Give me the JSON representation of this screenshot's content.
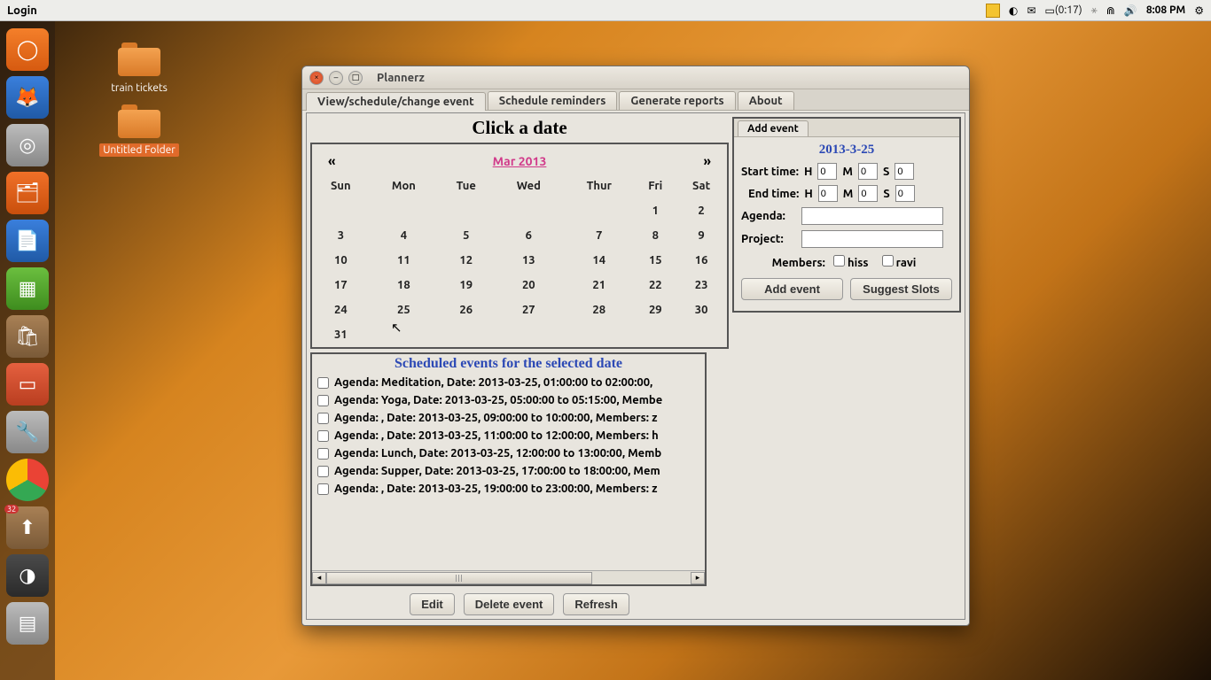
{
  "topbar": {
    "title": "Login",
    "battery": "(0:17)",
    "time": "8:08 PM"
  },
  "desktop": {
    "folder1": "train tickets",
    "folder2": "Untitled Folder"
  },
  "window": {
    "title": "Plannerz",
    "tabs": [
      "View/schedule/change event",
      "Schedule reminders",
      "Generate reports",
      "About"
    ],
    "heading": "Click a date"
  },
  "calendar": {
    "prev": "«",
    "next": "»",
    "month": "Mar 2013",
    "days": [
      "Sun",
      "Mon",
      "Tue",
      "Wed",
      "Thur",
      "Fri",
      "Sat"
    ],
    "weeks": [
      [
        "",
        "",
        "",
        "",
        "",
        "1",
        "2"
      ],
      [
        "3",
        "4",
        "5",
        "6",
        "7",
        "8",
        "9"
      ],
      [
        "10",
        "11",
        "12",
        "13",
        "14",
        "15",
        "16"
      ],
      [
        "17",
        "18",
        "19",
        "20",
        "21",
        "22",
        "23"
      ],
      [
        "24",
        "25",
        "26",
        "27",
        "28",
        "29",
        "30"
      ],
      [
        "31",
        "",
        "",
        "",
        "",
        "",
        ""
      ]
    ]
  },
  "form": {
    "tab": "Add event",
    "date": "2013-3-25",
    "start_label": "Start time:",
    "end_label": "End time:",
    "h": "H",
    "m": "M",
    "s": "S",
    "start": {
      "h": "0",
      "m": "0",
      "s": "0"
    },
    "end": {
      "h": "0",
      "m": "0",
      "s": "0"
    },
    "agenda_label": "Agenda:",
    "project_label": "Project:",
    "members_label": "Members:",
    "member1": "hiss",
    "member2": "ravi",
    "add_btn": "Add event",
    "suggest_btn": "Suggest Slots"
  },
  "events": {
    "title": "Scheduled events for the selected date",
    "list": [
      "Agenda: Meditation, Date: 2013-03-25, 01:00:00 to 02:00:00, ",
      "Agenda: Yoga, Date: 2013-03-25, 05:00:00 to 05:15:00, Membe",
      "Agenda: , Date: 2013-03-25, 09:00:00 to 10:00:00, Members: z",
      "Agenda: , Date: 2013-03-25, 11:00:00 to 12:00:00, Members: h",
      "Agenda: Lunch, Date: 2013-03-25, 12:00:00 to 13:00:00, Memb",
      "Agenda: Supper, Date: 2013-03-25, 17:00:00 to 18:00:00, Mem",
      "Agenda: , Date: 2013-03-25, 19:00:00 to 23:00:00, Members: z"
    ]
  },
  "buttons": {
    "edit": "Edit",
    "delete": "Delete event",
    "refresh": "Refresh"
  },
  "launcher_badge": "32"
}
